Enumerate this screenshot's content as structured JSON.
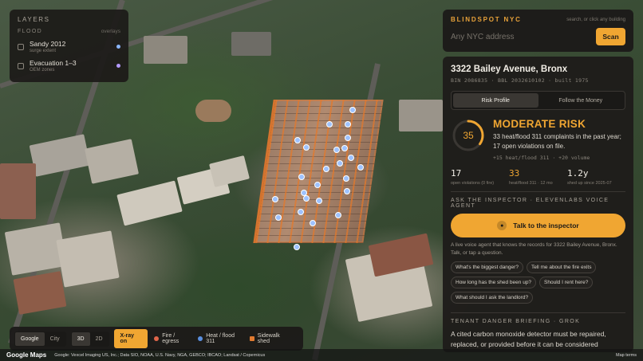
{
  "colors": {
    "accent": "#f0a632",
    "fire": "#e0654a",
    "heat": "#5a8fe0",
    "sidewalk": "#e07a30",
    "flood_sandy": "#8ab6ff",
    "flood_evac": "#b49aff"
  },
  "layers": {
    "title": "LAYERS",
    "section": "FLOOD",
    "section_note": "overlays",
    "items": [
      {
        "name": "Sandy 2012",
        "sub": "surge extent"
      },
      {
        "name": "Evacuation 1–3",
        "sub": "OEM zones"
      }
    ]
  },
  "search": {
    "brand": "BLINDSPOT NYC",
    "hint": "search, or click any building",
    "placeholder": "Any NYC address",
    "button": "Scan"
  },
  "building": {
    "address": "3322 Bailey Avenue, Bronx",
    "meta": "BIN 2086835 · BBL 2032610102 · built 1975"
  },
  "tabs": [
    {
      "label": "Risk Profile"
    },
    {
      "label": "Follow the Money"
    }
  ],
  "risk": {
    "score": "35",
    "score_value": 35,
    "score_max": 100,
    "level": "MODERATE RISK",
    "description": "33 heat/flood 311 complaints in the past year; 17 open violations on file.",
    "trend": "+15 heat/flood 311 · +20 volume"
  },
  "stats": [
    {
      "value": "17",
      "label": "open violations (0 fire)"
    },
    {
      "value": "33",
      "label": "heat/flood 311 · 12 mo"
    },
    {
      "value": "1.2y",
      "label": "shed up since 2025-07"
    }
  ],
  "voice": {
    "title": "ASK THE INSPECTOR · ELEVENLABS VOICE AGENT",
    "button": "Talk to the inspector",
    "description": "A live voice agent that knows the records for 3322 Bailey Avenue, Bronx. Talk, or tap a question.",
    "questions": [
      "What's the biggest danger?",
      "Tell me about the fire exits",
      "How long has the shed been up?",
      "Should I rent here?",
      "What should I ask the landlord?"
    ]
  },
  "briefing": {
    "title": "TENANT DANGER BRIEFING · GROK",
    "text": "A cited carbon monoxide detector must be repaired, replaced, or provided before it can be considered operational, the most serious open safety issue. Open"
  },
  "toolbar": {
    "map_google": "Google",
    "map_city": "City",
    "view_3d": "3D",
    "view_2d": "2D",
    "xray": "X-ray on",
    "legend": [
      {
        "label": "Fire / egress"
      },
      {
        "label": "Heat / flood 311"
      },
      {
        "label": "Sidewalk shed"
      }
    ]
  },
  "google": {
    "logo": "Google Maps",
    "attribution": "Google: Vexcel Imaging US, Inc.; Data SIO, NOAA, U.S. Navy, NGA, GEBCO; IBCAO; Landsat / Copernicus",
    "terms": "Map terms"
  }
}
